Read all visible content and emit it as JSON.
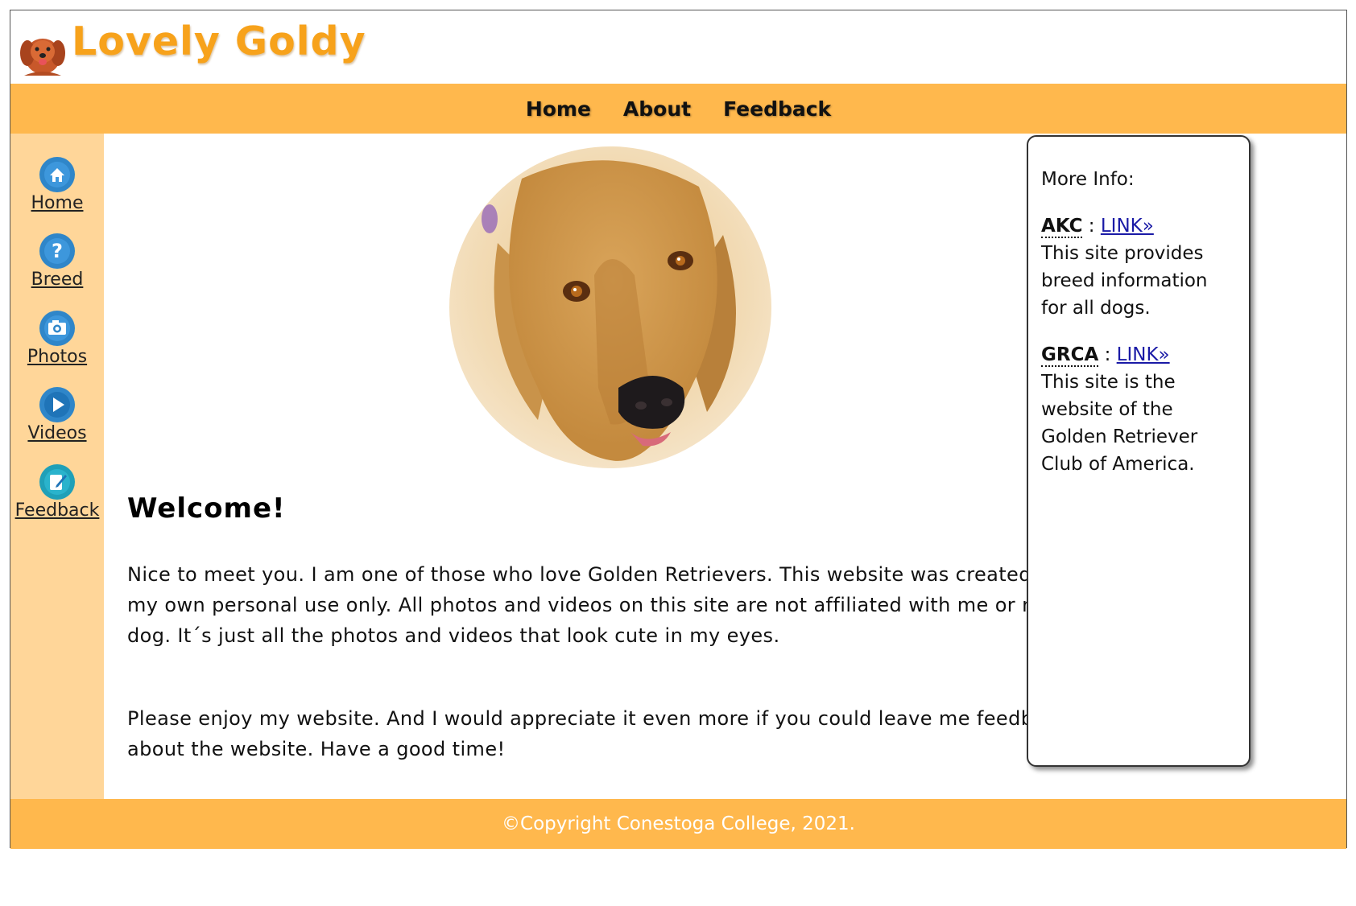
{
  "site": {
    "brand": "Lovely Goldy"
  },
  "topnav": {
    "items": [
      "Home",
      "About",
      "Feedback"
    ]
  },
  "sidebar": {
    "items": [
      {
        "label": "Home",
        "icon": "home-icon"
      },
      {
        "label": "Breed",
        "icon": "question-icon"
      },
      {
        "label": "Photos",
        "icon": "camera-icon"
      },
      {
        "label": "Videos",
        "icon": "play-icon"
      },
      {
        "label": "Feedback",
        "icon": "edit-note-icon"
      }
    ]
  },
  "main": {
    "heading": "Welcome!",
    "paragraphs": [
      "Nice to meet you. I am one of those who love Golden Retrievers. This website was created for my own personal use only. All photos and videos on this site are not affiliated with me or my dog. It´s just all the photos and videos that look cute in my eyes.",
      "Please enjoy my website. And I would appreciate it even more if you could leave me feedback about the website. Have a good time!"
    ]
  },
  "info": {
    "title": "More Info:",
    "entries": [
      {
        "abbr": "AKC",
        "separator": " : ",
        "link": "LINK»",
        "text": "This site provides breed information for all dogs."
      },
      {
        "abbr": "GRCA",
        "separator": " : ",
        "link": "LINK»",
        "text": "This site is the website of the Golden Retriever Club of America."
      }
    ]
  },
  "footer": {
    "text": "©Copyright Conestoga College, 2021."
  },
  "colors": {
    "brand": "#f7a21b",
    "nav_bar": "#ffb84d",
    "sidebar": "#ffd699",
    "icon_blue": "#2f86c9",
    "link": "#1a1aa6"
  }
}
